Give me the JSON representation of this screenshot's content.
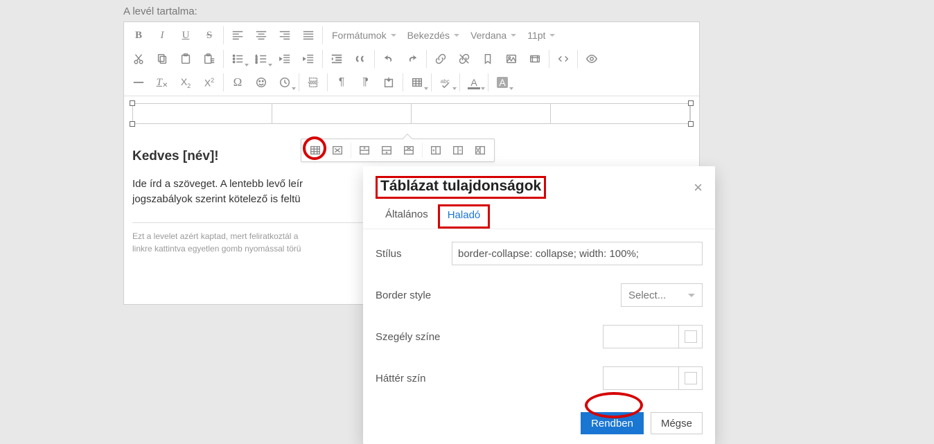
{
  "page_label": "A levél tartalma:",
  "toolbar": {
    "dropdowns": {
      "formats": "Formátumok",
      "blocks": "Bekezdés",
      "font": "Verdana",
      "size": "11pt"
    }
  },
  "content": {
    "greeting": "Kedves [név]!",
    "body_line1": "Ide írd a szöveget. A lentebb levő leír",
    "body_line2": "jogszabályok szerint kötelező is feltü",
    "footer_line1": "Ezt a levelet azért kaptad, mert feliratkoztál a",
    "footer_line2": "linkre kattintva egyetlen gomb nyomással törü"
  },
  "dialog": {
    "title": "Táblázat tulajdonságok",
    "tabs": {
      "general": "Általános",
      "advanced": "Haladó"
    },
    "fields": {
      "style_label": "Stílus",
      "style_value": "border-collapse: collapse; width: 100%;",
      "border_style_label": "Border style",
      "border_style_value": "Select...",
      "border_color_label": "Szegély színe",
      "bg_color_label": "Háttér szín"
    },
    "buttons": {
      "ok": "Rendben",
      "cancel": "Mégse"
    }
  }
}
